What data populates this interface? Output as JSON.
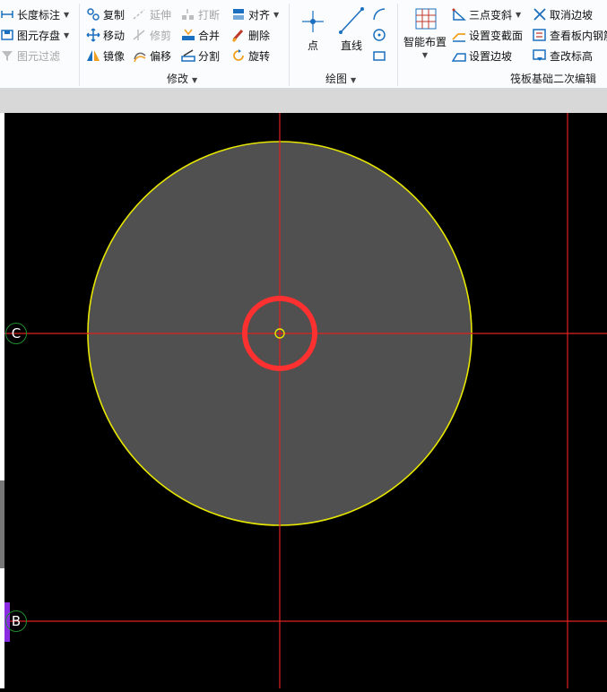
{
  "ribbon": {
    "col1": [
      {
        "label": "长度标注",
        "icon": "dimension-icon",
        "dropdown": true,
        "disabled": false
      },
      {
        "label": "图元存盘",
        "icon": "save-element-icon",
        "dropdown": true,
        "disabled": false
      },
      {
        "label": "图元过滤",
        "icon": "filter-icon",
        "dropdown": false,
        "disabled": true
      }
    ],
    "modify": {
      "group_label": "修改",
      "col1": [
        {
          "label": "复制",
          "icon": "copy-icon",
          "disabled": false
        },
        {
          "label": "移动",
          "icon": "move-icon",
          "disabled": false
        },
        {
          "label": "镜像",
          "icon": "mirror-icon",
          "disabled": false
        }
      ],
      "col2": [
        {
          "label": "延伸",
          "icon": "extend-icon",
          "disabled": true
        },
        {
          "label": "修剪",
          "icon": "trim-icon",
          "disabled": true
        },
        {
          "label": "偏移",
          "icon": "offset-icon",
          "disabled": false
        }
      ],
      "col3": [
        {
          "label": "打断",
          "icon": "break-icon",
          "disabled": true
        },
        {
          "label": "合并",
          "icon": "merge-icon",
          "disabled": false
        },
        {
          "label": "分割",
          "icon": "split-icon",
          "disabled": false
        }
      ],
      "col4": [
        {
          "label": "对齐",
          "icon": "align-icon",
          "dropdown": true,
          "disabled": false
        },
        {
          "label": "删除",
          "icon": "delete-icon",
          "disabled": false
        },
        {
          "label": "旋转",
          "icon": "rotate-icon",
          "disabled": false
        }
      ]
    },
    "draw": {
      "group_label": "绘图",
      "point_label": "点",
      "line_label": "直线"
    },
    "raft": {
      "group_label": "筏板基础二次编辑",
      "smart_label": "智能布置",
      "col2": [
        {
          "label": "三点变斜",
          "icon": "three-point-slope-icon",
          "dropdown": true
        },
        {
          "label": "设置变截面",
          "icon": "variable-section-icon"
        },
        {
          "label": "设置边坡",
          "icon": "set-slope-icon"
        }
      ],
      "col3": [
        {
          "label": "取消边坡",
          "icon": "cancel-slope-icon"
        },
        {
          "label": "查看板内钢筋",
          "icon": "view-rebar-icon"
        },
        {
          "label": "查改标高",
          "icon": "elevation-icon"
        }
      ]
    }
  },
  "canvas": {
    "axis_labels": [
      "C",
      "B"
    ],
    "colors": {
      "background": "#000000",
      "grid": "#e02020",
      "circle_fill": "#505050",
      "circle_stroke": "#e6e600",
      "highlight": "#ff3030",
      "axis_bubble": "#1f8f2e"
    }
  }
}
